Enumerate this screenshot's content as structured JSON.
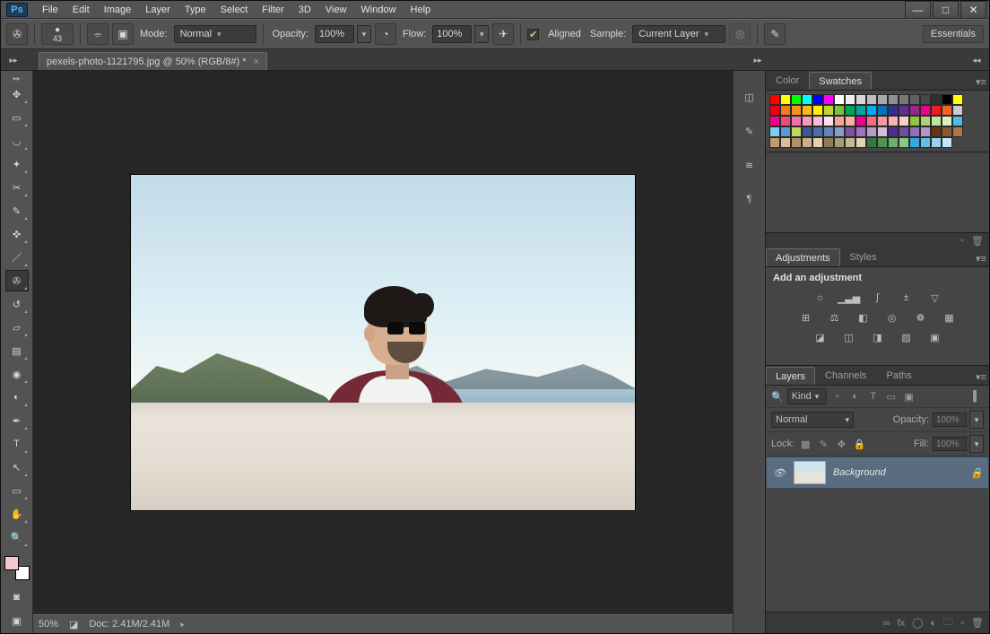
{
  "app": {
    "logo": "Ps"
  },
  "menus": [
    "File",
    "Edit",
    "Image",
    "Layer",
    "Type",
    "Select",
    "Filter",
    "3D",
    "View",
    "Window",
    "Help"
  ],
  "win": {
    "min": "—",
    "max": "□",
    "close": "✕"
  },
  "options": {
    "brush_size": "43",
    "mode_label": "Mode:",
    "mode_value": "Normal",
    "opacity_label": "Opacity:",
    "opacity_value": "100%",
    "flow_label": "Flow:",
    "flow_value": "100%",
    "aligned_label": "Aligned",
    "sample_label": "Sample:",
    "sample_value": "Current Layer",
    "workspace_btn": "Essentials"
  },
  "document": {
    "tab_title": "pexels-photo-1121795.jpg @ 50% (RGB/8#) *",
    "zoom": "50%",
    "doc_size": "Doc: 2.41M/2.41M"
  },
  "tools": [
    {
      "name": "move-tool",
      "glyph": "✥"
    },
    {
      "name": "marquee-tool",
      "glyph": "▭"
    },
    {
      "name": "lasso-tool",
      "glyph": "◡"
    },
    {
      "name": "magic-wand-tool",
      "glyph": "✦"
    },
    {
      "name": "crop-tool",
      "glyph": "✂"
    },
    {
      "name": "eyedropper-tool",
      "glyph": "✎"
    },
    {
      "name": "patch-tool",
      "glyph": "✜"
    },
    {
      "name": "brush-tool",
      "glyph": "／"
    },
    {
      "name": "clone-stamp-tool",
      "glyph": "✇",
      "active": true
    },
    {
      "name": "history-brush-tool",
      "glyph": "↺"
    },
    {
      "name": "eraser-tool",
      "glyph": "▱"
    },
    {
      "name": "gradient-tool",
      "glyph": "▤"
    },
    {
      "name": "blur-tool",
      "glyph": "◉"
    },
    {
      "name": "dodge-tool",
      "glyph": "◐"
    },
    {
      "name": "pen-tool",
      "glyph": "✒"
    },
    {
      "name": "type-tool",
      "glyph": "T"
    },
    {
      "name": "path-select-tool",
      "glyph": "↖"
    },
    {
      "name": "shape-tool",
      "glyph": "▭"
    },
    {
      "name": "hand-tool",
      "glyph": "✋"
    },
    {
      "name": "zoom-tool",
      "glyph": "🔍"
    }
  ],
  "panels": {
    "color_tab": "Color",
    "swatches_tab": "Swatches",
    "swatches": [
      "#ff0000",
      "#ffff00",
      "#00ff00",
      "#00ffff",
      "#0000ff",
      "#ff00ff",
      "#ffffff",
      "#efefef",
      "#d7d7d7",
      "#bfbfbf",
      "#a8a8a8",
      "#909090",
      "#787878",
      "#606060",
      "#484848",
      "#303030",
      "#000000",
      "#ffff00",
      "#ec0015",
      "#f47c20",
      "#f7941e",
      "#fdb813",
      "#fff100",
      "#c1d82f",
      "#7ac142",
      "#00a650",
      "#00a99d",
      "#00aeef",
      "#0072bc",
      "#2e3192",
      "#662d91",
      "#92278f",
      "#ec008c",
      "#ed1c24",
      "#f26522",
      "#cccccc",
      "#ed008c",
      "#ef4b81",
      "#f173ac",
      "#f499c1",
      "#f8bcd7",
      "#fce0ec",
      "#f9a29d",
      "#f7b0a6",
      "#ec008c",
      "#f26d7d",
      "#f5989d",
      "#f9b1b1",
      "#fbd0c7",
      "#8dc63f",
      "#aad372",
      "#c3e299",
      "#dbefc0",
      "#53b7e8",
      "#7fcdf0",
      "#539dd4",
      "#bcd85f",
      "#3b5998",
      "#4a6ea9",
      "#6784b7",
      "#879ec6",
      "#7d52a1",
      "#9a77b8",
      "#b79bc9",
      "#d4bfdb",
      "#4c2f91",
      "#6e4ea3",
      "#9072b5",
      "#b296c8",
      "#633517",
      "#8a5a2f",
      "#a9794a",
      "#c29a6c",
      "#dcbe95",
      "#b28f64",
      "#cbb087",
      "#e3d1ac",
      "#8c7d54",
      "#a89a72",
      "#c4b890",
      "#e0d6ae",
      "#327a3d",
      "#4e9553",
      "#6cae6b",
      "#8cc884",
      "#36a9e1",
      "#66bde9",
      "#96d1f0",
      "#c6e5f8"
    ],
    "adjustments_tab": "Adjustments",
    "styles_tab": "Styles",
    "adjustments_title": "Add an adjustment",
    "adj_icons_r1": [
      "brightness",
      "levels",
      "curves",
      "exposure",
      "vibrance"
    ],
    "adj_icons_r2": [
      "hue",
      "balance",
      "bw",
      "photo-filter",
      "mixer",
      "lookup"
    ],
    "adj_icons_r3": [
      "invert",
      "posterize",
      "threshold",
      "map",
      "selective"
    ],
    "layers_tab": "Layers",
    "channels_tab": "Channels",
    "paths_tab": "Paths",
    "filter_label": "Kind",
    "blend_mode": "Normal",
    "opacity_l": "Opacity:",
    "opacity_v": "100%",
    "lock_l": "Lock:",
    "fill_l": "Fill:",
    "fill_v": "100%",
    "layers": [
      {
        "name": "Background",
        "locked": true,
        "visible": true
      }
    ],
    "lf_icons": [
      "link",
      "fx",
      "mask",
      "adjust",
      "group",
      "new",
      "trash"
    ]
  },
  "glyph": {
    "search": "🔍",
    "caret": "▾",
    "caret_r": "▸",
    "caret_l": "◂",
    "check": "✔",
    "eye": "👁",
    "lock": "🔒",
    "menu": "≡",
    "trash": "🗑",
    "link": "∞",
    "new_layer": "▫",
    "bright": "☼",
    "levels": "▁▃▅",
    "curves": "∫",
    "exposure": "±",
    "vibrance": "▽",
    "hue": "⊞",
    "balance": "⚖",
    "bw": "◧",
    "filter": "◎",
    "mixer": "❁",
    "lookup": "▦",
    "invert": "◪",
    "poster": "◫",
    "thresh": "◨",
    "map": "▧",
    "selcol": "▣",
    "page": "▫"
  }
}
